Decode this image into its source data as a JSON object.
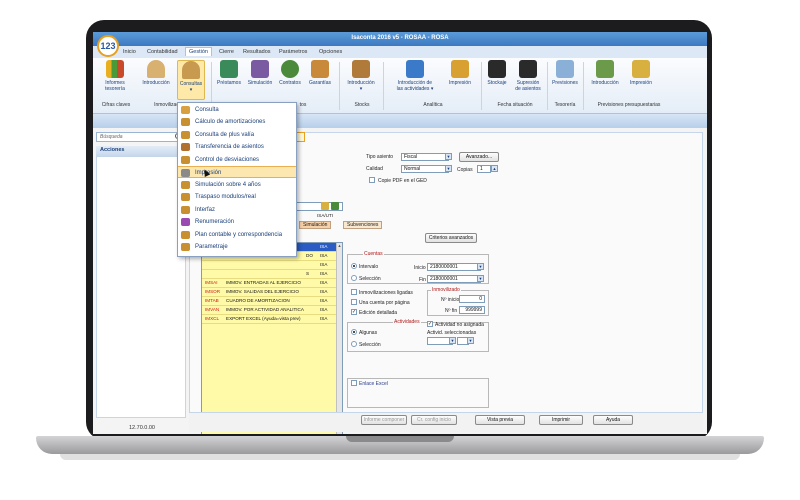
{
  "app": {
    "title": "Isaconta 2016 v5 - ROSAA - ROSA",
    "logo_text": "123",
    "version": "12.70.0.00"
  },
  "menubar": [
    "Inicio",
    "Contabilidad",
    "Gestión",
    "Cierre",
    "Resultados",
    "Parámetros",
    "Opciones"
  ],
  "ribbon": {
    "buttons": [
      {
        "label": "Informes",
        "label2": "tesorería"
      },
      {
        "label": "Introducción",
        "label2": ""
      },
      {
        "label": "Consultas",
        "label2": "▾"
      },
      {
        "label": "Préstamos",
        "label2": ""
      },
      {
        "label": "Simulación",
        "label2": ""
      },
      {
        "label": "Contratos",
        "label2": ""
      },
      {
        "label": "Garantías",
        "label2": ""
      },
      {
        "label": "Introducción",
        "label2": "▾"
      },
      {
        "label": "Introducción de",
        "label2": "las actividades ▾"
      },
      {
        "label": "Impresión",
        "label2": ""
      },
      {
        "label": "Stockaje",
        "label2": ""
      },
      {
        "label": "Supresión",
        "label2": "de asientos"
      },
      {
        "label": "Previsiones",
        "label2": ""
      },
      {
        "label": "Introducción",
        "label2": ""
      },
      {
        "label": "Impresión",
        "label2": ""
      }
    ],
    "groups": [
      "Cifras claves",
      "Inmovilizado",
      "tos",
      "Stocks",
      "Analítica",
      "Fecha situación",
      "Tesorería",
      "Previsiones presupuestarias"
    ]
  },
  "left": {
    "search_placeholder": "Búsqueda",
    "acciones_label": "Acciones"
  },
  "dropdown": {
    "items": [
      "Consulta",
      "Cálculo de amortizaciones",
      "Consulta de plus valía",
      "Transferencia de asientos",
      "Control de desviaciones",
      "Impresión",
      "Simulación sobre 4 años",
      "Traspaso modulos/real",
      "Interfaz",
      "Renumeración",
      "Plan contable y correspondencia",
      "Parametraje"
    ],
    "hover_index": 5
  },
  "form": {
    "tipo_asiento_label": "Tipo asiento",
    "tipo_asiento_value": "Fiscal",
    "avanzado_button": "Avanzado...",
    "calidad_label": "Calidad",
    "calidad_value": "Normal",
    "copias_label": "Copias",
    "copias_value": "1",
    "copie_pdf_label": "Copie PDF en el GED",
    "criterios_button": "Criterios avanzados",
    "subtabs": [
      "Simulación",
      "Subvenciones"
    ],
    "cuentas_title": "Cuentas",
    "intervalo_label": "Intervalo",
    "seleccion_label": "Selección",
    "inicio_label": "Inicio",
    "inicio_value": "2180000001",
    "fin_label": "Fin",
    "fin_value": "2180000001",
    "inmov_ligadas_label": "Inmovilizaciones ligadas",
    "una_cuenta_label": "Una cuenta por página",
    "edicion_label": "Edición detallada",
    "inmovilizado_title": "Inmovilizado",
    "n_inicio_label": "Nº inicio",
    "n_inicio_value": "0",
    "n_fin_label": "Nº fin",
    "n_fin_value": "999999",
    "actividades_title": "Actividades",
    "algunas_label": "Algunas",
    "seleccion2_label": "Selección",
    "actividad_no_asignada": "Actividad no asignada",
    "actividades_seleccionadas": "Activid. seleccionadas",
    "enlace_excel": "Enlace Excel"
  },
  "grid": {
    "header_sis": "ISA/UTI",
    "rows": [
      {
        "code": "",
        "desc": "",
        "sis": "ISA",
        "hl": true
      },
      {
        "code": "",
        "desc": "DO",
        "sis": "ISA",
        "hl": false
      },
      {
        "code": "",
        "desc": "",
        "sis": "ISA",
        "hl": false
      },
      {
        "code": "",
        "desc": "S",
        "sis": "ISA",
        "hl": false
      },
      {
        "code": "IMSAI",
        "desc": "IMMOV. ENTRADAS AL EJERCICIO",
        "sis": "ISA",
        "hl": false
      },
      {
        "code": "IMSOR",
        "desc": "IMMOV. SALIDAS DEL EJERCICIO",
        "sis": "ISA",
        "hl": false
      },
      {
        "code": "IMTAB",
        "desc": "CUADRO DE AMORTIZACION",
        "sis": "ISA",
        "hl": false
      },
      {
        "code": "IMVAN",
        "desc": "IMMOV. POR ACTIVIDAD ANALITICA",
        "sis": "ISA",
        "hl": false
      },
      {
        "code": "IMXCL",
        "desc": "EXPORT EXCEL (Ayuda=vista prev)",
        "sis": "ISA",
        "hl": false
      }
    ]
  },
  "bottom": {
    "informe": "Informe componer",
    "config": "Cr. config inicio",
    "vista": "Vista previa",
    "imprimir": "Imprimir",
    "ayuda": "Ayuda"
  }
}
